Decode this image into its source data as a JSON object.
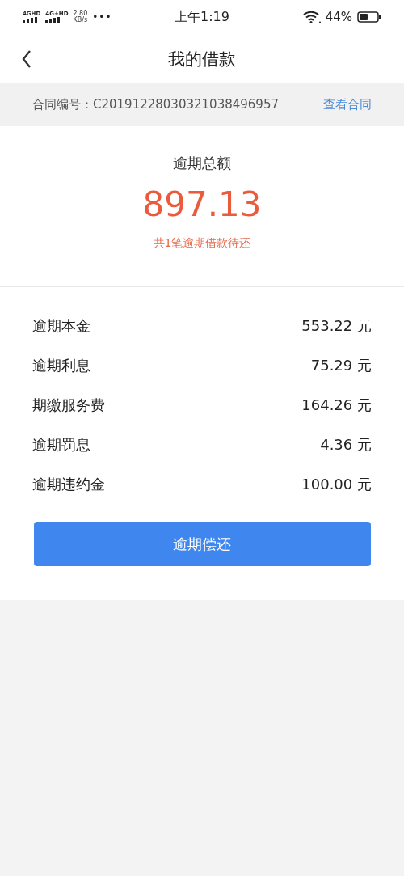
{
  "status_bar": {
    "network_1": "4G",
    "network_1_sup": "HD",
    "network_2": "4G",
    "network_2_sup": "+HD",
    "speed_value": "2.80",
    "speed_unit": "KB/s",
    "more": "•••",
    "time": "上午1:19",
    "battery_text": "44%"
  },
  "nav": {
    "title": "我的借款"
  },
  "contract": {
    "label": "合同编号：C20191228030321038496957",
    "link": "查看合同"
  },
  "summary": {
    "title": "逾期总额",
    "amount": "897.13",
    "note": "共1笔逾期借款待还"
  },
  "items": [
    {
      "label": "逾期本金",
      "value": "553.22 元"
    },
    {
      "label": "逾期利息",
      "value": "75.29 元"
    },
    {
      "label": "期缴服务费",
      "value": "164.26 元"
    },
    {
      "label": "逾期罚息",
      "value": "4.36 元"
    },
    {
      "label": "逾期违约金",
      "value": "100.00 元"
    }
  ],
  "button": {
    "label": "逾期偿还"
  }
}
